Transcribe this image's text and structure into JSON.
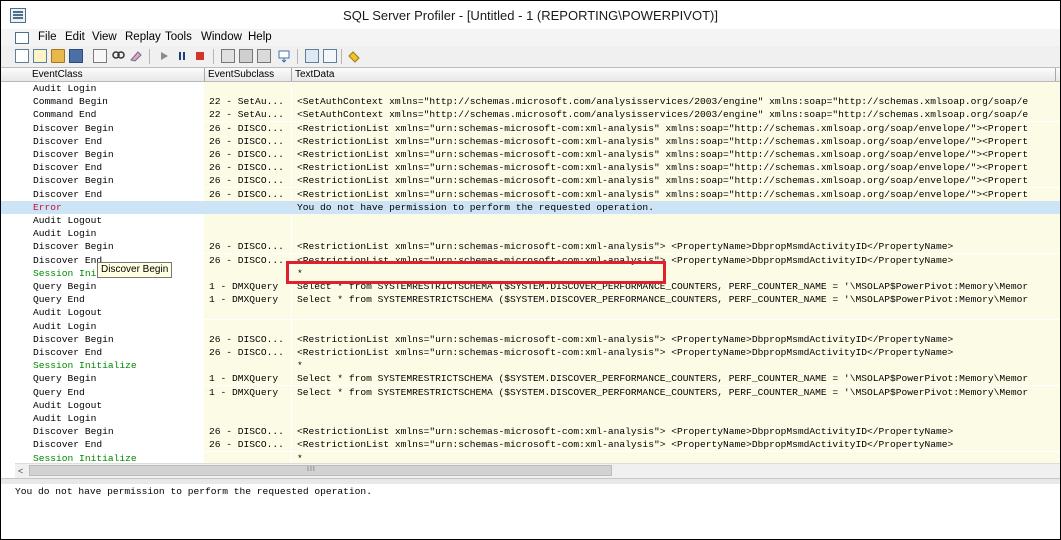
{
  "window": {
    "title": "SQL Server Profiler - [Untitled - 1 (REPORTING\\POWERPIVOT)]"
  },
  "menu": [
    "File",
    "Edit",
    "View",
    "Replay",
    "Tools",
    "Window",
    "Help"
  ],
  "toolbar": {
    "buttons": [
      "new-trace-icon",
      "new-template-icon",
      "open-icon",
      "save-icon",
      "properties-icon",
      "find-icon",
      "clear-icon",
      "start-icon",
      "pause-icon",
      "stop-icon",
      "column-filters-icon",
      "organize-columns-icon",
      "auto-scroll-icon",
      "bookmark-icon",
      "sql-server-icon",
      "performance-monitor-icon",
      "help-icon"
    ]
  },
  "columns": [
    "EventClass",
    "EventSubclass",
    "TextData"
  ],
  "rows": [
    {
      "event": "Audit Login",
      "sub": "",
      "text": "",
      "style": "normal"
    },
    {
      "event": "Command Begin",
      "sub": "22 - SetAu...",
      "text": "<SetAuthContext xmlns=\"http://schemas.microsoft.com/analysisservices/2003/engine\" xmlns:soap=\"http://schemas.xmlsoap.org/soap/e",
      "style": "normal"
    },
    {
      "event": "Command End",
      "sub": "22 - SetAu...",
      "text": "<SetAuthContext xmlns=\"http://schemas.microsoft.com/analysisservices/2003/engine\" xmlns:soap=\"http://schemas.xmlsoap.org/soap/e",
      "style": "normal"
    },
    {
      "event": "Discover Begin",
      "sub": "26 - DISCO...",
      "text": "<RestrictionList xmlns=\"urn:schemas-microsoft-com:xml-analysis\" xmlns:soap=\"http://schemas.xmlsoap.org/soap/envelope/\"><Propert",
      "style": "normal"
    },
    {
      "event": "Discover End",
      "sub": "26 - DISCO...",
      "text": "<RestrictionList xmlns=\"urn:schemas-microsoft-com:xml-analysis\" xmlns:soap=\"http://schemas.xmlsoap.org/soap/envelope/\"><Propert",
      "style": "normal"
    },
    {
      "event": "Discover Begin",
      "sub": "26 - DISCO...",
      "text": "<RestrictionList xmlns=\"urn:schemas-microsoft-com:xml-analysis\" xmlns:soap=\"http://schemas.xmlsoap.org/soap/envelope/\"><Propert",
      "style": "normal"
    },
    {
      "event": "Discover End",
      "sub": "26 - DISCO...",
      "text": "<RestrictionList xmlns=\"urn:schemas-microsoft-com:xml-analysis\" xmlns:soap=\"http://schemas.xmlsoap.org/soap/envelope/\"><Propert",
      "style": "normal"
    },
    {
      "event": "Discover Begin",
      "sub": "26 - DISCO...",
      "text": "<RestrictionList xmlns=\"urn:schemas-microsoft-com:xml-analysis\" xmlns:soap=\"http://schemas.xmlsoap.org/soap/envelope/\"><Propert",
      "style": "normal"
    },
    {
      "event": "Discover End",
      "sub": "26 - DISCO...",
      "text": "<RestrictionList xmlns=\"urn:schemas-microsoft-com:xml-analysis\" xmlns:soap=\"http://schemas.xmlsoap.org/soap/envelope/\"><Propert",
      "style": "normal"
    },
    {
      "event": "Error",
      "sub": "",
      "text": "You do not have permission to perform the requested operation.",
      "style": "error"
    },
    {
      "event": "Audit Logout",
      "sub": "",
      "text": "",
      "style": "normal"
    },
    {
      "event": "Audit Login",
      "sub": "",
      "text": "",
      "style": "normal"
    },
    {
      "event": "Discover Begin",
      "sub": "26 - DISCO...",
      "text": "<RestrictionList xmlns=\"urn:schemas-microsoft-com:xml-analysis\">          <PropertyName>DbpropMsmdActivityID</PropertyName>",
      "style": "normal"
    },
    {
      "event": "Discover End",
      "sub": "26 - DISCO...",
      "text": "<RestrictionList xmlns=\"urn:schemas-microsoft-com:xml-analysis\">          <PropertyName>DbpropMsmdActivityID</PropertyName>",
      "style": "normal"
    },
    {
      "event": "Session Initialize",
      "sub": "",
      "text": "*",
      "style": "session"
    },
    {
      "event": "Query Begin",
      "sub": "1 - DMXQuery",
      "text": "Select * from SYSTEMRESTRICTSCHEMA ($SYSTEM.DISCOVER_PERFORMANCE_COUNTERS, PERF_COUNTER_NAME = '\\MSOLAP$PowerPivot:Memory\\Memor",
      "style": "normal"
    },
    {
      "event": "Query End",
      "sub": "1 - DMXQuery",
      "text": "Select * from SYSTEMRESTRICTSCHEMA ($SYSTEM.DISCOVER_PERFORMANCE_COUNTERS, PERF_COUNTER_NAME = '\\MSOLAP$PowerPivot:Memory\\Memor",
      "style": "normal"
    },
    {
      "event": "Audit Logout",
      "sub": "",
      "text": "",
      "style": "normal"
    },
    {
      "event": "Audit Login",
      "sub": "",
      "text": "",
      "style": "normal"
    },
    {
      "event": "Discover Begin",
      "sub": "26 - DISCO...",
      "text": "<RestrictionList xmlns=\"urn:schemas-microsoft-com:xml-analysis\">          <PropertyName>DbpropMsmdActivityID</PropertyName>",
      "style": "normal"
    },
    {
      "event": "Discover End",
      "sub": "26 - DISCO...",
      "text": "<RestrictionList xmlns=\"urn:schemas-microsoft-com:xml-analysis\">          <PropertyName>DbpropMsmdActivityID</PropertyName>",
      "style": "normal"
    },
    {
      "event": "Session Initialize",
      "sub": "",
      "text": "*",
      "style": "session"
    },
    {
      "event": "Query Begin",
      "sub": "1 - DMXQuery",
      "text": "Select * from SYSTEMRESTRICTSCHEMA ($SYSTEM.DISCOVER_PERFORMANCE_COUNTERS, PERF_COUNTER_NAME = '\\MSOLAP$PowerPivot:Memory\\Memor",
      "style": "normal"
    },
    {
      "event": "Query End",
      "sub": "1 - DMXQuery",
      "text": "Select * from SYSTEMRESTRICTSCHEMA ($SYSTEM.DISCOVER_PERFORMANCE_COUNTERS, PERF_COUNTER_NAME = '\\MSOLAP$PowerPivot:Memory\\Memor",
      "style": "normal"
    },
    {
      "event": "Audit Logout",
      "sub": "",
      "text": "",
      "style": "normal"
    },
    {
      "event": "Audit Login",
      "sub": "",
      "text": "",
      "style": "normal"
    },
    {
      "event": "Discover Begin",
      "sub": "26 - DISCO...",
      "text": "<RestrictionList xmlns=\"urn:schemas-microsoft-com:xml-analysis\">          <PropertyName>DbpropMsmdActivityID</PropertyName>",
      "style": "normal"
    },
    {
      "event": "Discover End",
      "sub": "26 - DISCO...",
      "text": "<RestrictionList xmlns=\"urn:schemas-microsoft-com:xml-analysis\">          <PropertyName>DbpropMsmdActivityID</PropertyName>",
      "style": "normal"
    },
    {
      "event": "Session Initialize",
      "sub": "",
      "text": "*",
      "style": "session"
    }
  ],
  "tooltip": "Discover Begin",
  "scrollbar": {
    "grip": "III",
    "left_arrow": "<"
  },
  "detail": {
    "text": "You do not have permission to perform the requested operation."
  },
  "colors": {
    "error": "#c8102e",
    "session": "#008a00",
    "selection": "#cde4f7",
    "highlight": "#e0202a"
  }
}
